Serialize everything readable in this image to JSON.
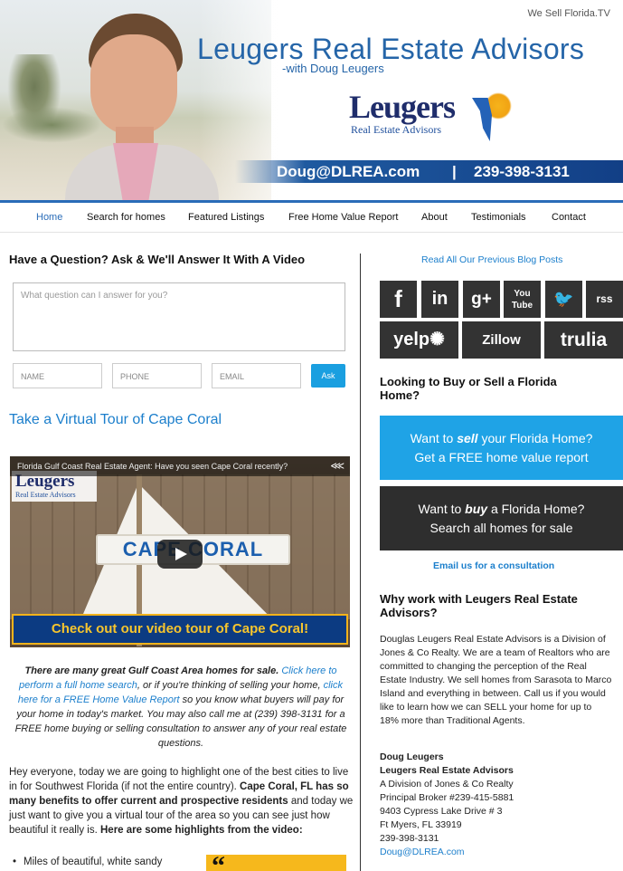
{
  "header": {
    "site_tag": "We Sell Florida.TV",
    "title": "Leugers Real Estate Advisors",
    "subtitle": "-with Doug Leugers",
    "logo_brand": "Leugers",
    "logo_tag": "Real Estate Advisors",
    "contact_email": "Doug@DLREA.com",
    "contact_sep": "|",
    "contact_phone": "239-398-3131"
  },
  "nav": {
    "items": [
      "Home",
      "Search for homes",
      "Featured Listings",
      "Free Home Value Report",
      "About",
      "Testimonials",
      "Contact"
    ],
    "active_color": "#2a6cb8"
  },
  "question_form": {
    "title": "Have a Question? Ask & We'll Answer It With A Video",
    "question_placeholder": "What question can I answer for you?",
    "name_placeholder": "NAME",
    "phone_placeholder": "PHONE",
    "email_placeholder": "EMAIL",
    "ask_label": "Ask"
  },
  "tour": {
    "title": "Take a Virtual Tour of Cape Coral",
    "video_title": "Florida Gulf Coast Real Estate Agent: Have you seen Cape Coral recently?",
    "video_sign": "CAPE CORAL",
    "video_caption": "Check out our video tour of Cape Coral!",
    "video_logo_brand": "Leugers",
    "video_logo_tag": "Real Estate Advisors"
  },
  "intro_italic": {
    "lead": "There are many great Gulf Coast Area homes for sale.",
    "link1": "Click here to perform a full home search",
    "mid": ", or if you're thinking of selling your home,",
    "link2": "click here for a FREE Home Value Report",
    "tail": "so you know what buyers will pay for your home in today's market. You may also call me at (239) 398-3131 for a FREE home buying or selling consultation to answer any of your real estate questions."
  },
  "body": {
    "p1_a": "Hey everyone, today we are going to highlight one of the best cities to live in for Southwest Florida (if not the entire country).",
    "p1_b": "Cape Coral, FL has so many benefits to offer current and prospective residents",
    "p1_c": "and today we just want to give you a virtual tour of the area so you can see just how beautiful it really is.",
    "p1_d": "Here are some highlights from the video:",
    "bullet1": "Miles of beautiful, white sandy",
    "quote_mark": "“"
  },
  "sidebar": {
    "blog_link": "Read All Our Previous Blog Posts",
    "social": {
      "facebook": "f",
      "linkedin": "in",
      "googleplus": "g+",
      "youtube": "You Tube",
      "twitter": "🐦",
      "rss": "rss",
      "yelp": "yelp✺",
      "zillow": "Zillow",
      "trulia": "trulia"
    },
    "looking_title": "Looking to Buy or Sell a Florida Home?",
    "sell_cta": {
      "pre": "Want to",
      "verb": "sell",
      "post": "your Florida Home?",
      "line2": "Get a FREE home value report"
    },
    "buy_cta": {
      "pre": "Want to",
      "verb": "buy",
      "post": "a Florida Home?",
      "line2": "Search all homes for sale"
    },
    "email_consult": "Email us for a consultation",
    "why_title": "Why work with Leugers Real Estate Advisors?",
    "why_text": "Douglas Leugers Real Estate Advisors is a Division of Jones & Co Realty. We are a team of Realtors who are committed to changing the perception of the Real Estate Industry. We sell homes from Sarasota to Marco Island and everything in between. Call us if you would like to learn how we can SELL your home for up to 18% more than Traditional Agents.",
    "contact": {
      "name": "Doug Leugers",
      "company": "Leugers Real Estate Advisors",
      "division": "A Division of Jones & Co Realty",
      "broker": "Principal Broker #239-415-5881",
      "street": "9403 Cypress Lake Drive # 3",
      "city": "Ft Myers, FL 33919",
      "phone": "239-398-3131",
      "email": "Doug@DLREA.com"
    },
    "colors": {
      "sell_bg": "#1fa3e6",
      "buy_bg": "#2e2e2e",
      "link": "#1c7fcc"
    }
  }
}
